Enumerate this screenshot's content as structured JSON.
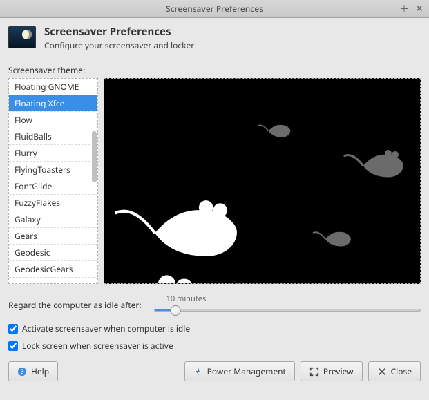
{
  "titlebar": {
    "title": "Screensaver Preferences"
  },
  "header": {
    "title": "Screensaver Preferences",
    "subtitle": "Configure your screensaver and locker"
  },
  "theme_label": "Screensaver theme:",
  "themes": [
    "Floating GNOME",
    "Floating Xfce",
    "Flow",
    "FluidBalls",
    "Flurry",
    "FlyingToasters",
    "FontGlide",
    "FuzzyFlakes",
    "Galaxy",
    "Gears",
    "Geodesic",
    "GeodesicGears",
    "GFlux"
  ],
  "selected_theme_index": 1,
  "idle": {
    "label": "Regard the computer as idle after:",
    "value_label": "10 minutes"
  },
  "options": {
    "activate": {
      "label": "Activate screensaver when computer is idle",
      "checked": true
    },
    "lock": {
      "label": "Lock screen when screensaver is active",
      "checked": true
    }
  },
  "buttons": {
    "help": "Help",
    "power": "Power Management",
    "preview": "Preview",
    "close": "Close"
  }
}
